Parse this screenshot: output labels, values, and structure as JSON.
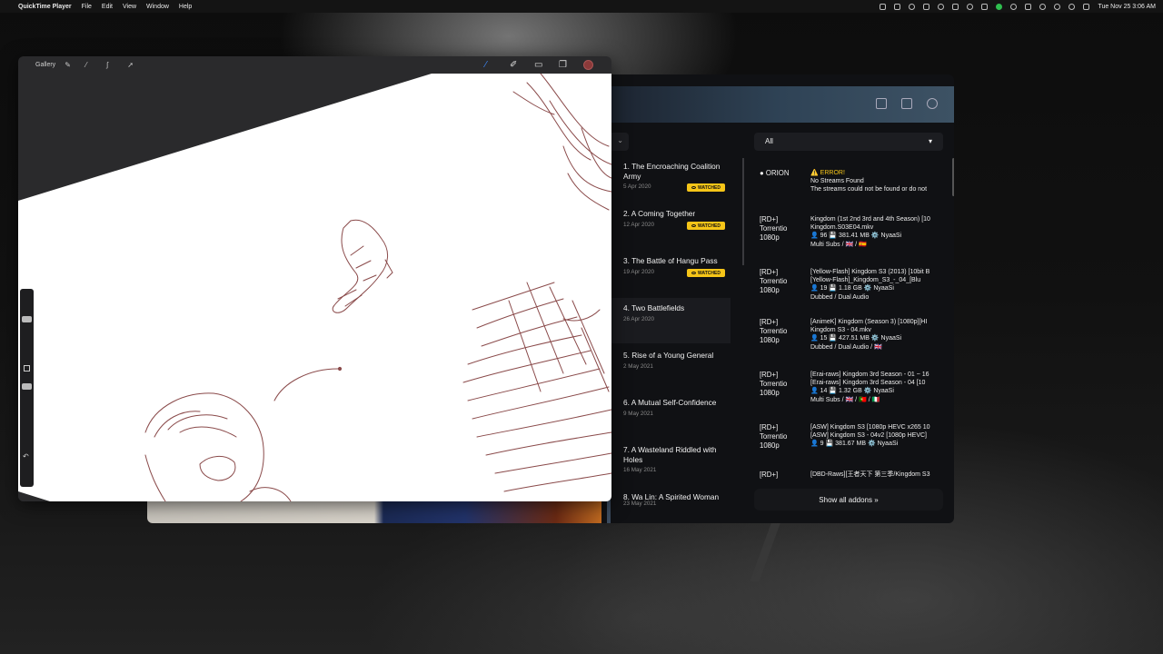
{
  "menubar": {
    "app_name": "QuickTime Player",
    "menus": [
      "File",
      "Edit",
      "View",
      "Window",
      "Help"
    ],
    "datetime": "Tue Nov 25  3:06 AM"
  },
  "draw_app": {
    "gallery_label": "Gallery",
    "tools_left": [
      "wrench-icon",
      "magic-wand-icon",
      "selection-icon",
      "transform-icon"
    ],
    "tools_right": [
      "brush-icon",
      "smudge-icon",
      "eraser-icon",
      "layers-icon"
    ],
    "current_color": "#8b3a3a",
    "stroke_color": "#8a4a4a"
  },
  "stream_app": {
    "season_dropdown": "⌄",
    "filter_dropdown": "All",
    "episodes": [
      {
        "title": "1. The Encroaching Coalition Army",
        "date": "5 Apr 2020",
        "watched": "WATCHED"
      },
      {
        "title": "2. A Coming Together",
        "date": "12 Apr 2020",
        "watched": "WATCHED"
      },
      {
        "title": "3. The Battle of Hangu Pass",
        "date": "19 Apr 2020",
        "watched": "WATCHED"
      },
      {
        "title": "4. Two Battlefields",
        "date": "26 Apr 2020",
        "watched": ""
      },
      {
        "title": "5. Rise of a Young General",
        "date": "2 May 2021",
        "watched": ""
      },
      {
        "title": "6. A Mutual Self-Confidence",
        "date": "9 May 2021",
        "watched": ""
      },
      {
        "title": "7. A Wasteland Riddled with Holes",
        "date": "16 May 2021",
        "watched": ""
      },
      {
        "title": "8. Wa Lin: A Spirited Woman",
        "date": "23 May 2021",
        "watched": ""
      }
    ],
    "streams": [
      {
        "source": [
          "ORION"
        ],
        "lines": [
          "⚠️ ERROR!",
          "No Streams Found",
          "The streams could not be found or do not"
        ]
      },
      {
        "source": [
          "[RD+]",
          "Torrentio",
          "1080p"
        ],
        "lines": [
          "Kingdom (1st 2nd 3rd and 4th Season) [10",
          "Kingdom.S03E04.mkv",
          "👤 96 💾 381.41 MB ⚙️ NyaaSi",
          "Multi Subs / 🇬🇧 / 🇪🇸"
        ]
      },
      {
        "source": [
          "[RD+]",
          "Torrentio",
          "1080p"
        ],
        "lines": [
          "[Yellow-Flash] Kingdom S3 (2013) [10bit B",
          "[Yellow-Flash]_Kingdom_S3_-_04_[Blu",
          "👤 19 💾 1.18 GB ⚙️ NyaaSi",
          "Dubbed / Dual Audio"
        ]
      },
      {
        "source": [
          "[RD+]",
          "Torrentio",
          "1080p"
        ],
        "lines": [
          "[AnimeK] Kingdom (Season 3) [1080p][HI",
          "Kingdom S3 - 04.mkv",
          "👤 15 💾 427.51 MB ⚙️ NyaaSi",
          "Dubbed / Dual Audio / 🇬🇧"
        ]
      },
      {
        "source": [
          "[RD+]",
          "Torrentio",
          "1080p"
        ],
        "lines": [
          "[Erai-raws] Kingdom 3rd Season - 01 ~ 16",
          "[Erai-raws] Kingdom 3rd Season - 04 [10",
          "👤 14 💾 1.32 GB ⚙️ NyaaSi",
          "Multi Subs / 🇬🇧 / 🇵🇹 / 🇮🇹"
        ]
      },
      {
        "source": [
          "[RD+]",
          "Torrentio",
          "1080p"
        ],
        "lines": [
          "[ASW] Kingdom S3 [1080p HEVC x265 10",
          "[ASW] Kingdom S3 - 04v2 [1080p HEVC]",
          "👤 9 💾 381.67 MB ⚙️ NyaaSi"
        ]
      },
      {
        "source": [
          "[RD+]"
        ],
        "lines": [
          "[DBD-Raws][王者天下 第三季/Kingdom S3"
        ]
      }
    ],
    "show_all_label": "Show all addons »"
  }
}
